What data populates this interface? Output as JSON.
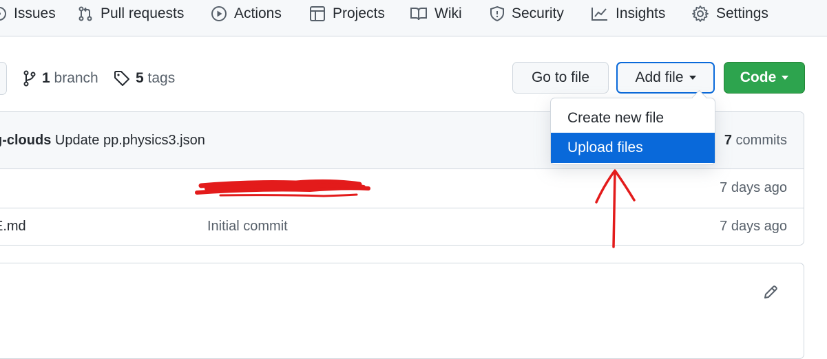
{
  "colors": {
    "accent": "#0969da",
    "code_button": "#2da44e",
    "annotation": "#e31b1b"
  },
  "nav": {
    "items": [
      {
        "label": "Issues",
        "icon": "issue-opened-icon"
      },
      {
        "label": "Pull requests",
        "icon": "git-pull-request-icon"
      },
      {
        "label": "Actions",
        "icon": "play-icon"
      },
      {
        "label": "Projects",
        "icon": "table-icon"
      },
      {
        "label": "Wiki",
        "icon": "book-icon"
      },
      {
        "label": "Security",
        "icon": "shield-icon"
      },
      {
        "label": "Insights",
        "icon": "graph-icon"
      },
      {
        "label": "Settings",
        "icon": "gear-icon"
      }
    ]
  },
  "repo_meta": {
    "branch_count": "1",
    "branch_label": "branch",
    "tag_count": "5",
    "tag_label": "tags"
  },
  "toolbar": {
    "go_to_file": "Go to file",
    "add_file": "Add file",
    "code": "Code"
  },
  "add_file_menu": {
    "items": [
      "Create new file",
      "Upload files"
    ],
    "highlighted": "Upload files"
  },
  "commit_bar": {
    "author": "g-clouds",
    "message": "Update pp.physics3.json",
    "commit_count": "7",
    "commit_label": "commits"
  },
  "files": [
    {
      "name": "",
      "message": "",
      "age": "7 days ago"
    },
    {
      "name": "E.md",
      "message": "Initial commit",
      "age": "7 days ago"
    }
  ]
}
